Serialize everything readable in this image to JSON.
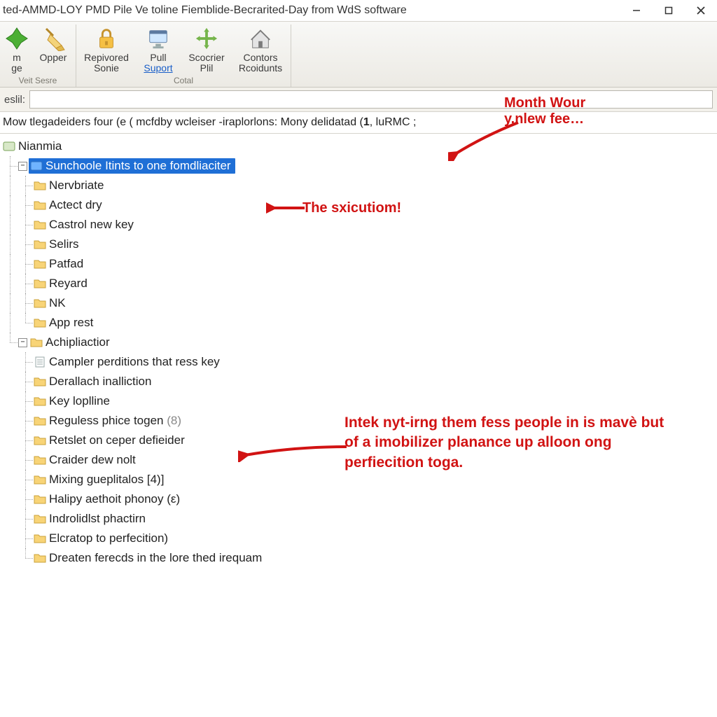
{
  "window": {
    "title": "ted-AMMD-LOY PMD Pile Ve toline Fiemblide-Becrarited-Day from WdS software"
  },
  "ribbon": {
    "group1": {
      "label": "Veit Sesre",
      "buttons": [
        {
          "id": "m-ge",
          "line1": "m",
          "line2": "ge",
          "icon": "green-plus"
        },
        {
          "id": "opper",
          "line1": "Opper",
          "line2": "",
          "icon": "broom"
        }
      ]
    },
    "group2": {
      "label": "Cotal",
      "buttons": [
        {
          "id": "repivored",
          "line1": "Repivored",
          "line2": "Sonie",
          "icon": "lock"
        },
        {
          "id": "pull",
          "line1": "Pull",
          "line2_u": "Suport",
          "icon": "monitor"
        },
        {
          "id": "scoorier",
          "line1": "Scocrier",
          "line2": "Plil",
          "icon": "arrows"
        },
        {
          "id": "contors",
          "line1": "Contors",
          "line2": "Rcoidunts",
          "icon": "house"
        }
      ]
    }
  },
  "search": {
    "label": "eslil:",
    "value": ""
  },
  "status": {
    "text_pre": "Mow tlegadeiders four (e ( mcfdby wcleiser -iraplorlons: Mony delidatad (",
    "bold": "1",
    "text_post": ", luRMC ;"
  },
  "tree": {
    "root_label": "Nianmia",
    "nodes": [
      {
        "label": "Sunchoole Itints to one fomdliaciter",
        "selected": true,
        "children": [
          {
            "label": "Nervbriate"
          },
          {
            "label": "Actect dry"
          },
          {
            "label": "Castrol new key"
          },
          {
            "label": "Selirs"
          },
          {
            "label": "Patfad"
          },
          {
            "label": "Reyard"
          },
          {
            "label": "NK"
          },
          {
            "label": "App rest"
          }
        ]
      },
      {
        "label": "Achipliactior",
        "children": [
          {
            "label": "Campler perditions that ress key",
            "file": true
          },
          {
            "label": "Derallach inalliction"
          },
          {
            "label": "Key loplline"
          },
          {
            "label": "Reguless phice togen",
            "suffix": "(8)"
          },
          {
            "label": "Retslet on ceper defieider"
          },
          {
            "label": "Craider dew nolt"
          },
          {
            "label": "Mixing gueplitalos [4)]"
          },
          {
            "label": "Halipy aethoit phonoy (ε)"
          },
          {
            "label": "Indrolidlst phactirn"
          },
          {
            "label": "Elcratop to perfecition)"
          },
          {
            "label": "Dreaten ferecds in the lore thed irequam"
          }
        ]
      }
    ]
  },
  "annotations": {
    "top_right": "Month Wour\ny.nlew fee…",
    "mid": "The sxicutiom!",
    "lower": "Intek nyt-irng them fess people in is mavè but of a imobilizer planance up alloon ong perfiecition toga."
  }
}
